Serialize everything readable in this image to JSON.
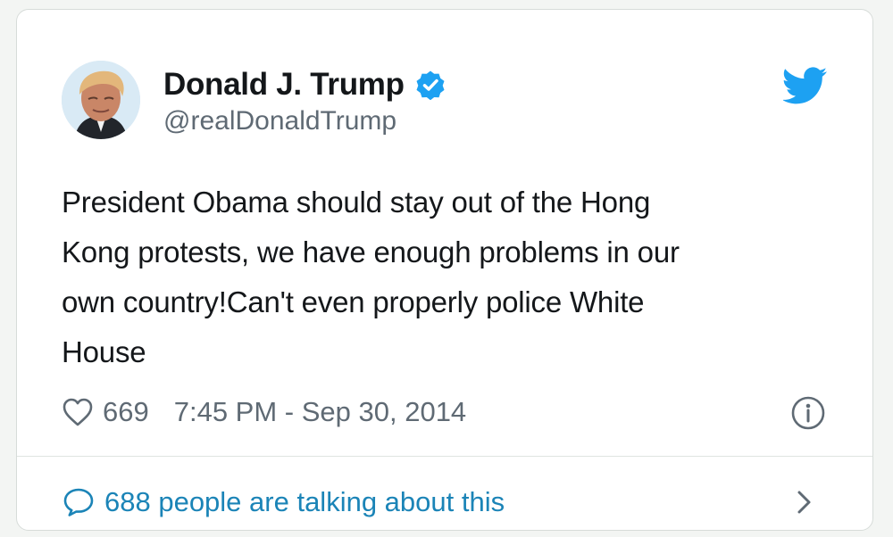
{
  "tweet": {
    "author": {
      "display_name": "Donald J. Trump",
      "handle": "@realDonaldTrump",
      "verified": true
    },
    "text": "President Obama should stay out of the Hong\nKong protests, we have enough problems in our\nown country!Can't even properly police White\nHouse",
    "like_count": "669",
    "timestamp": "7:45 PM - Sep 30, 2014",
    "talking_text": "688 people are talking about this",
    "icons": {
      "brand": "twitter-bird-icon",
      "verified": "verified-badge-icon",
      "likes": "heart-icon",
      "info": "info-icon",
      "comments": "speech-bubble-icon",
      "open": "chevron-right-icon"
    },
    "colors": {
      "accent": "#1da1f2",
      "link": "#1b84b7",
      "text": "#14171a",
      "muted": "#5f6a74"
    }
  }
}
